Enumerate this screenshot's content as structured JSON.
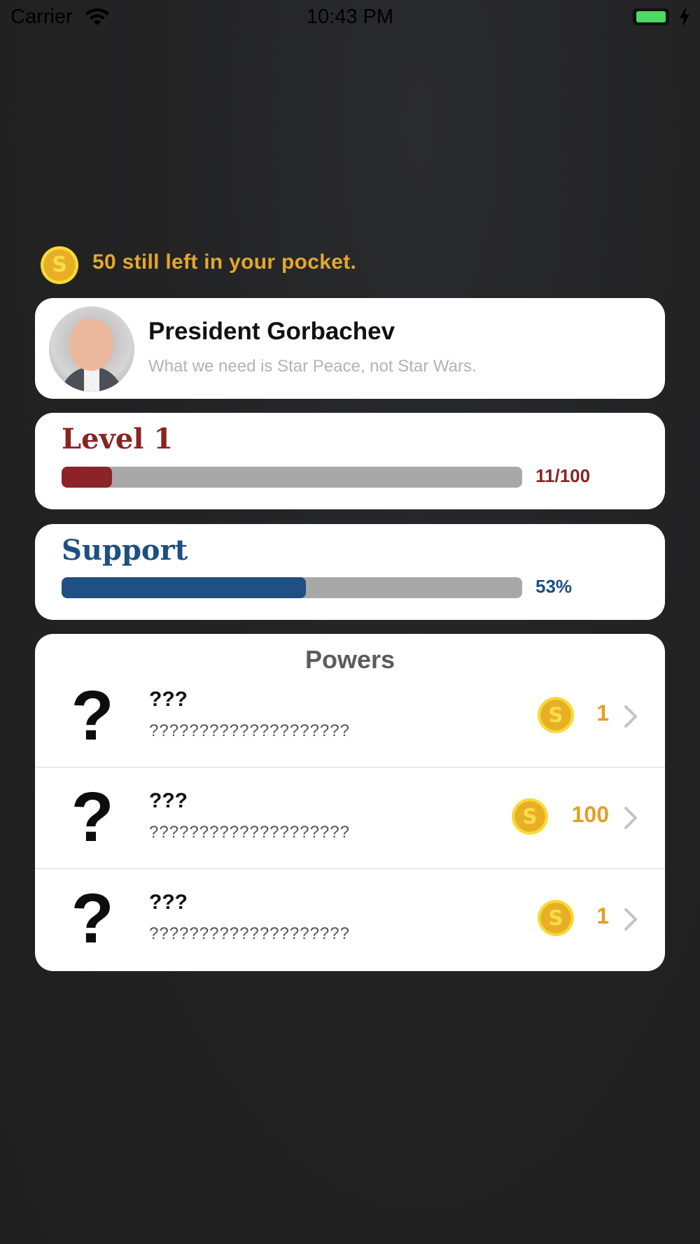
{
  "status_bar": {
    "carrier": "Carrier",
    "time": "10:43 PM",
    "battery_level": 0.95,
    "battery_color": "#4cd964"
  },
  "pocket": {
    "coin_symbol": "S",
    "text": "50 still left in your pocket."
  },
  "profile": {
    "name": "President Gorbachev",
    "quote": "What we need is Star Peace, not Star Wars."
  },
  "level": {
    "title": "Level 1",
    "value_text": "11/100",
    "fraction": 0.11,
    "color": "#8b2323"
  },
  "support": {
    "title": "Support",
    "value_text": "53%",
    "fraction": 0.53,
    "color": "#1d4f82"
  },
  "powers": {
    "title": "Powers",
    "items": [
      {
        "icon": "?",
        "name": "???",
        "description": "????????????????????",
        "coin_symbol": "S",
        "price": "1"
      },
      {
        "icon": "?",
        "name": "???",
        "description": "????????????????????",
        "coin_symbol": "S",
        "price": "100"
      },
      {
        "icon": "?",
        "name": "???",
        "description": "????????????????????",
        "coin_symbol": "S",
        "price": "1"
      }
    ]
  },
  "colors": {
    "coin_gold": "#e4a72e",
    "accent_red": "#8b2323",
    "accent_blue": "#1d4f82"
  },
  "icons": {
    "wifi": "wifi-icon",
    "battery": "battery-icon",
    "charging": "charging-bolt-icon",
    "coin": "coin-icon",
    "chevron": "chevron-right-icon",
    "unknown_power": "question-mark-icon"
  }
}
